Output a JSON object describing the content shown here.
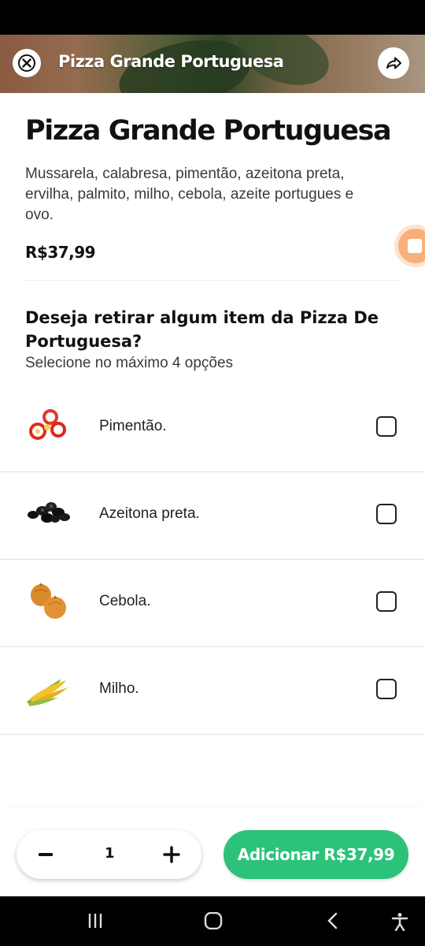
{
  "header": {
    "title": "Pizza Grande Portuguesa",
    "close_icon": "close-icon",
    "share_icon": "share-icon"
  },
  "product": {
    "name": "Pizza Grande Portuguesa",
    "description": "Mussarela, calabresa, pimentão, azeitona preta, ervilha, palmito, milho, cebola, azeite portugues e ovo.",
    "price": "R$37,99"
  },
  "question": {
    "title": "Deseja retirar algum item da Pizza De Portuguesa?",
    "subtitle": "Selecione no máximo 4 opções"
  },
  "options": [
    {
      "label": "Pimentão.",
      "icon": "pepper-icon",
      "checked": false
    },
    {
      "label": "Azeitona preta.",
      "icon": "olive-icon",
      "checked": false
    },
    {
      "label": "Cebola.",
      "icon": "onion-icon",
      "checked": false
    },
    {
      "label": "Milho.",
      "icon": "corn-icon",
      "checked": false
    }
  ],
  "footer": {
    "quantity": "1",
    "add_label": "Adicionar R$37,99"
  },
  "colors": {
    "accent_green": "#2dc27a",
    "fab_orange": "#f7b07a"
  }
}
